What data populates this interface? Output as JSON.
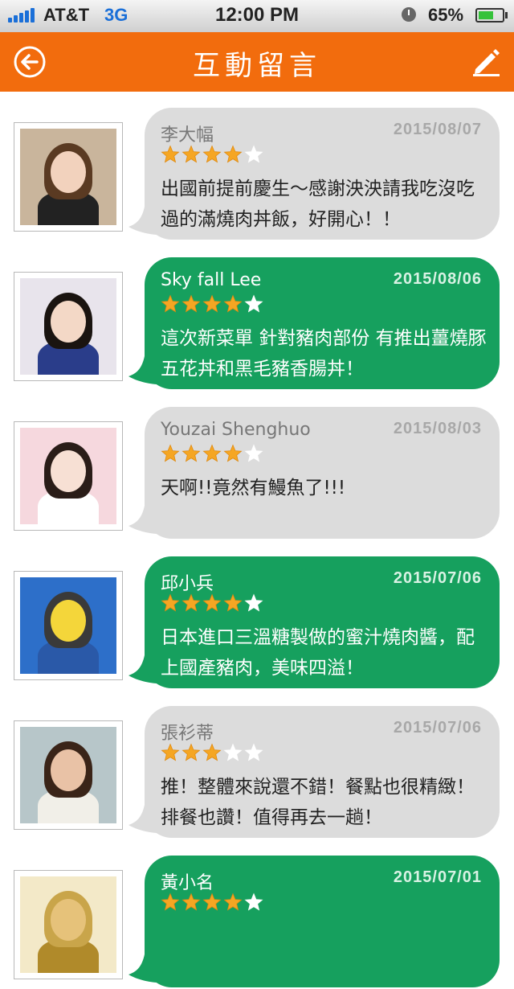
{
  "status_bar": {
    "carrier": "AT&T",
    "network": "3G",
    "time": "12:00 PM",
    "battery": "65%",
    "battery_level": 0.65
  },
  "header": {
    "title": "互動留言",
    "back_icon": "back-arrow-circle-icon",
    "edit_icon": "pencil-icon"
  },
  "colors": {
    "header": "#f26c0d",
    "bubble_gray": "#dcdcdc",
    "bubble_green": "#16a05e",
    "star_filled": "#f5a623",
    "star_empty": "#ffffff"
  },
  "comments": [
    {
      "name": "李大幅",
      "date": "2015/08/07",
      "rating": 4,
      "text": "出國前提前慶生～感謝泱泱請我吃沒吃過的滿燒肉丼飯，好開心！！",
      "style": "gray"
    },
    {
      "name": "Sky fall Lee",
      "date": "2015/08/06",
      "rating": 4,
      "text": "這次新菜單 針對豬肉部份 有推出薑燒豚五花丼和黑毛豬香腸丼！",
      "style": "green"
    },
    {
      "name": "Youzai Shenghuo",
      "date": "2015/08/03",
      "rating": 4,
      "text": "天啊!!竟然有鰻魚了!!!",
      "style": "gray"
    },
    {
      "name": "邱小兵",
      "date": "2015/07/06",
      "rating": 4,
      "text": "日本進口三溫糖製做的蜜汁燒肉醬，配上國產豬肉，美味四溢！",
      "style": "green"
    },
    {
      "name": "張衫蒂",
      "date": "2015/07/06",
      "rating": 3,
      "text": "推！整體來說還不錯！餐點也很精緻！排餐也讚！值得再去一趟！",
      "style": "gray"
    },
    {
      "name": "黃小名",
      "date": "2015/07/01",
      "rating": 4,
      "text": "",
      "style": "green"
    }
  ]
}
